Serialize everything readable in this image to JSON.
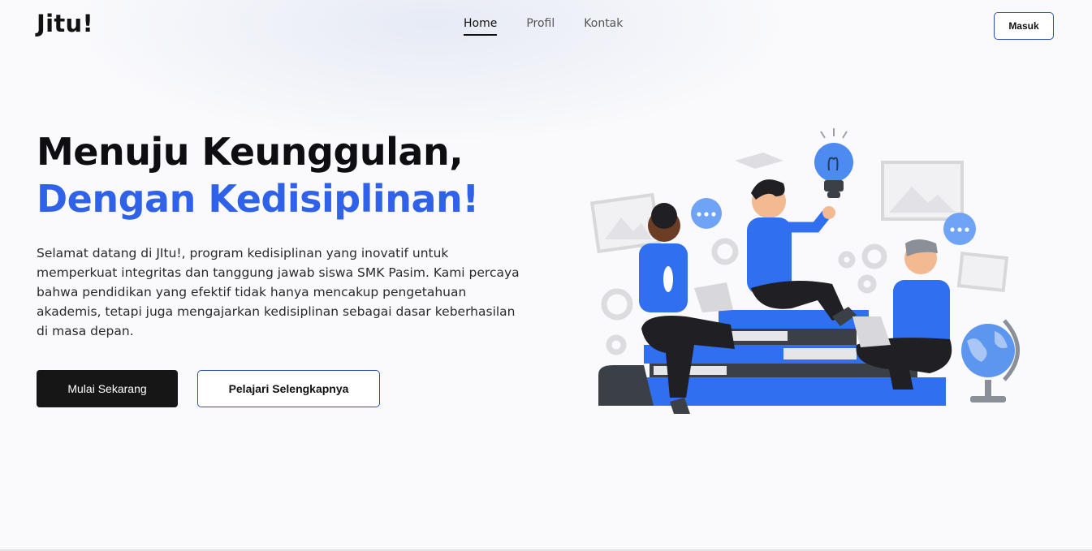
{
  "brand": {
    "logo": "Jitu!"
  },
  "nav": {
    "items": [
      "Home",
      "Profil",
      "Kontak"
    ],
    "active": "Home"
  },
  "header": {
    "login_label": "Masuk"
  },
  "hero": {
    "title_line1": "Menuju Keunggulan,",
    "title_line2": "Dengan Kedisiplinan!",
    "description": "Selamat datang di JItu!, program kedisiplinan yang inovatif untuk memperkuat integritas dan tanggung jawab siswa SMK Pasim. Kami percaya bahwa pendidikan yang efektif tidak hanya mencakup pengetahuan akademis, tetapi juga mengajarkan kedisiplinan sebagai dasar keberhasilan di masa depan.",
    "primary_button": "Mulai Sekarang",
    "secondary_button": "Pelajari Selengkapnya"
  },
  "colors": {
    "accent": "#2f62e8",
    "dark": "#161616",
    "border_accent": "#2a4fbf"
  },
  "illustration": {
    "icon": "students-studying-illustration"
  }
}
